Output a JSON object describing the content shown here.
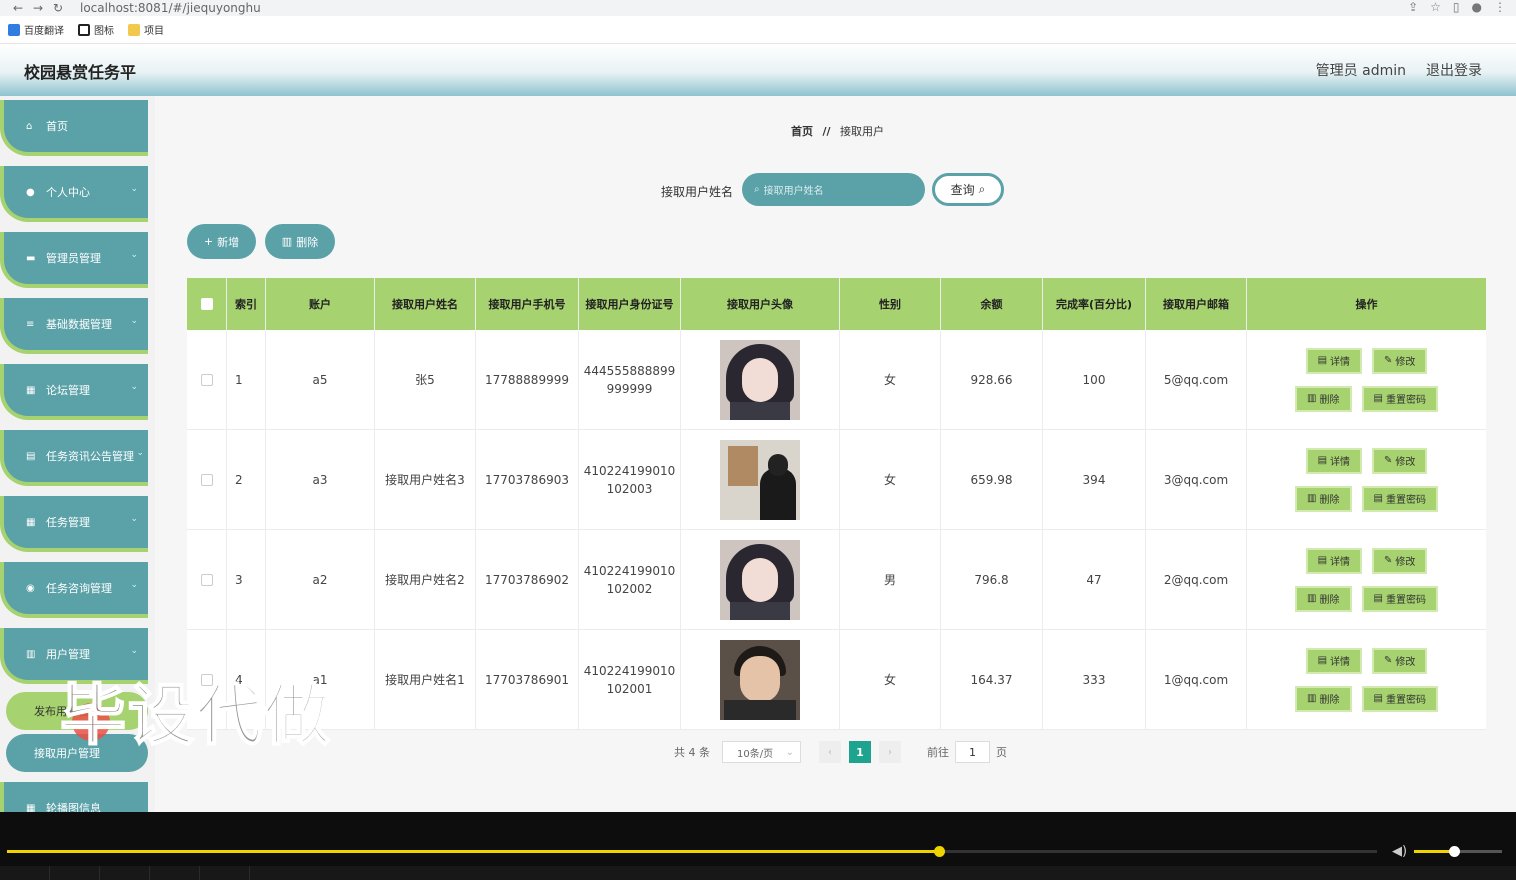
{
  "browser": {
    "url": "localhost:8081/#/jiequyonghu",
    "bookmarks": [
      "百度翻译",
      "图标",
      "项目"
    ]
  },
  "header": {
    "title": "校园悬赏任务平",
    "user": "管理员 admin",
    "logout": "退出登录"
  },
  "sidebar": {
    "items": [
      {
        "label": "首页",
        "icon": "home-icon",
        "top": 0
      },
      {
        "label": "个人中心",
        "icon": "user-icon"
      },
      {
        "label": "管理员管理",
        "icon": "chat-icon"
      },
      {
        "label": "基础数据管理",
        "icon": "list-icon"
      },
      {
        "label": "论坛管理",
        "icon": "grid-icon"
      },
      {
        "label": "任务资讯公告管理",
        "icon": "clipboard-icon"
      },
      {
        "label": "任务管理",
        "icon": "grid-icon"
      },
      {
        "label": "任务咨询管理",
        "icon": "pin-icon"
      },
      {
        "label": "用户管理",
        "icon": "bar-chart-icon"
      }
    ],
    "sub_items": [
      "发布用户管理",
      "接取用户管理"
    ],
    "last_item": "轮播图信息"
  },
  "breadcrumb": {
    "home": "首页",
    "sep": "//",
    "current": "接取用户"
  },
  "search": {
    "label": "接取用户姓名",
    "placeholder": "接取用户姓名",
    "button": "查询"
  },
  "toolbar": {
    "add": "新增",
    "delete": "删除"
  },
  "table": {
    "headers": [
      "索引",
      "账户",
      "接取用户姓名",
      "接取用户手机号",
      "接取用户身份证号",
      "接取用户头像",
      "性别",
      "余额",
      "完成率(百分比)",
      "接取用户邮箱",
      "操作"
    ],
    "rows": [
      {
        "index": "1",
        "account": "a5",
        "name": "张5",
        "phone": "17788889999",
        "idcard": "444555888899999999",
        "gender": "女",
        "balance": "928.66",
        "rate": "100",
        "email": "5@qq.com"
      },
      {
        "index": "2",
        "account": "a3",
        "name": "接取用户姓名3",
        "phone": "17703786903",
        "idcard": "410224199010102003",
        "gender": "女",
        "balance": "659.98",
        "rate": "394",
        "email": "3@qq.com"
      },
      {
        "index": "3",
        "account": "a2",
        "name": "接取用户姓名2",
        "phone": "17703786902",
        "idcard": "410224199010102002",
        "gender": "男",
        "balance": "796.8",
        "rate": "47",
        "email": "2@qq.com"
      },
      {
        "index": "4",
        "account": "a1",
        "name": "接取用户姓名1",
        "phone": "17703786901",
        "idcard": "410224199010102001",
        "gender": "女",
        "balance": "164.37",
        "rate": "333",
        "email": "1@qq.com"
      }
    ],
    "actions": {
      "detail": "详情",
      "edit": "修改",
      "delete": "删除",
      "reset": "重置密码"
    }
  },
  "pagination": {
    "total": "共 4 条",
    "page_size": "10条/页",
    "current": "1",
    "goto_label": "前往",
    "goto_value": "1",
    "page_unit": "页"
  },
  "watermark": "毕设代做",
  "video": {
    "progress": 0.68,
    "volume": 0.45
  },
  "colors": {
    "teal": "#5aa1a8",
    "green": "#a6d36f",
    "active_page": "#1ea48e"
  }
}
